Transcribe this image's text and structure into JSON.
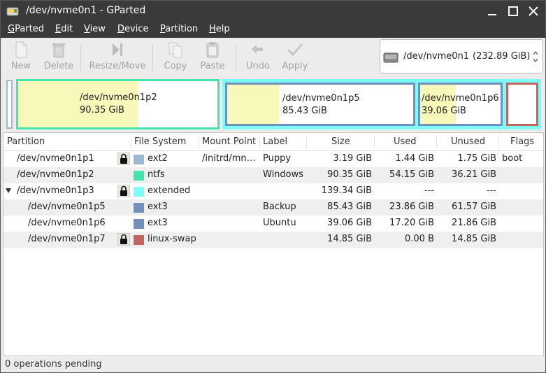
{
  "titlebar": {
    "title": "/dev/nvme0n1 - GParted"
  },
  "menu": [
    {
      "first": "G",
      "rest": "Parted"
    },
    {
      "first": "E",
      "rest": "dit"
    },
    {
      "first": "V",
      "rest": "iew"
    },
    {
      "first": "D",
      "rest": "evice"
    },
    {
      "first": "P",
      "rest": "artition"
    },
    {
      "first": "H",
      "rest": "elp"
    }
  ],
  "toolbar": {
    "new": "New",
    "delete": "Delete",
    "resize": "Resize/Move",
    "copy": "Copy",
    "paste": "Paste",
    "undo": "Undo",
    "apply": "Apply"
  },
  "device": {
    "name": "/dev/nvme0n1",
    "size": "(232.89 GiB)"
  },
  "map": {
    "p2": {
      "name": "/dev/nvme0n1p2",
      "size": "90.35 GiB",
      "used_fraction": 0.6
    },
    "p5": {
      "name": "/dev/nvme0n1p5",
      "size": "85.43 GiB",
      "used_fraction": 0.28
    },
    "p6": {
      "name": "/dev/nvme0n1p6",
      "size": "39.06 GiB",
      "used_fraction": 0.44
    }
  },
  "columns": {
    "partition": "Partition",
    "filesystem": "File System",
    "mount": "Mount Point",
    "label": "Label",
    "size": "Size",
    "used": "Used",
    "unused": "Unused",
    "flags": "Flags"
  },
  "rows": [
    {
      "partition": "/dev/nvme0n1p1",
      "fs": "ext2",
      "mount": "/initrd/mn…",
      "label": "Puppy",
      "size": "3.19 GiB",
      "used": "1.44 GiB",
      "unused": "1.75 GiB",
      "flags": "boot",
      "color": "#9db8d2"
    },
    {
      "partition": "/dev/nvme0n1p2",
      "fs": "ntfs",
      "mount": "",
      "label": "Windows",
      "size": "90.35 GiB",
      "used": "54.15 GiB",
      "unused": "36.21 GiB",
      "flags": "",
      "color": "#42e5ac"
    },
    {
      "partition": "/dev/nvme0n1p3",
      "fs": "extended",
      "mount": "",
      "label": "",
      "size": "139.34 GiB",
      "used": "---",
      "unused": "---",
      "flags": "",
      "color": "#7dfcfe"
    },
    {
      "partition": "/dev/nvme0n1p5",
      "fs": "ext3",
      "mount": "",
      "label": "Backup",
      "size": "85.43 GiB",
      "used": "23.86 GiB",
      "unused": "61.57 GiB",
      "flags": "",
      "color": "#7091bb"
    },
    {
      "partition": "/dev/nvme0n1p6",
      "fs": "ext3",
      "mount": "",
      "label": "Ubuntu",
      "size": "39.06 GiB",
      "used": "17.20 GiB",
      "unused": "21.86 GiB",
      "flags": "",
      "color": "#7091bb"
    },
    {
      "partition": "/dev/nvme0n1p7",
      "fs": "linux-swap",
      "mount": "",
      "label": "",
      "size": "14.85 GiB",
      "used": "0.00 B",
      "unused": "14.85 GiB",
      "flags": "",
      "color": "#c1665a"
    }
  ],
  "status": {
    "text": "0 operations pending"
  },
  "colors": {
    "ext2": "#9db8d2",
    "ntfs": "#42e5ac",
    "extended": "#7dfcfe",
    "ext3": "#7091bb",
    "swap": "#c1665a",
    "used": "#f8f8ba"
  }
}
